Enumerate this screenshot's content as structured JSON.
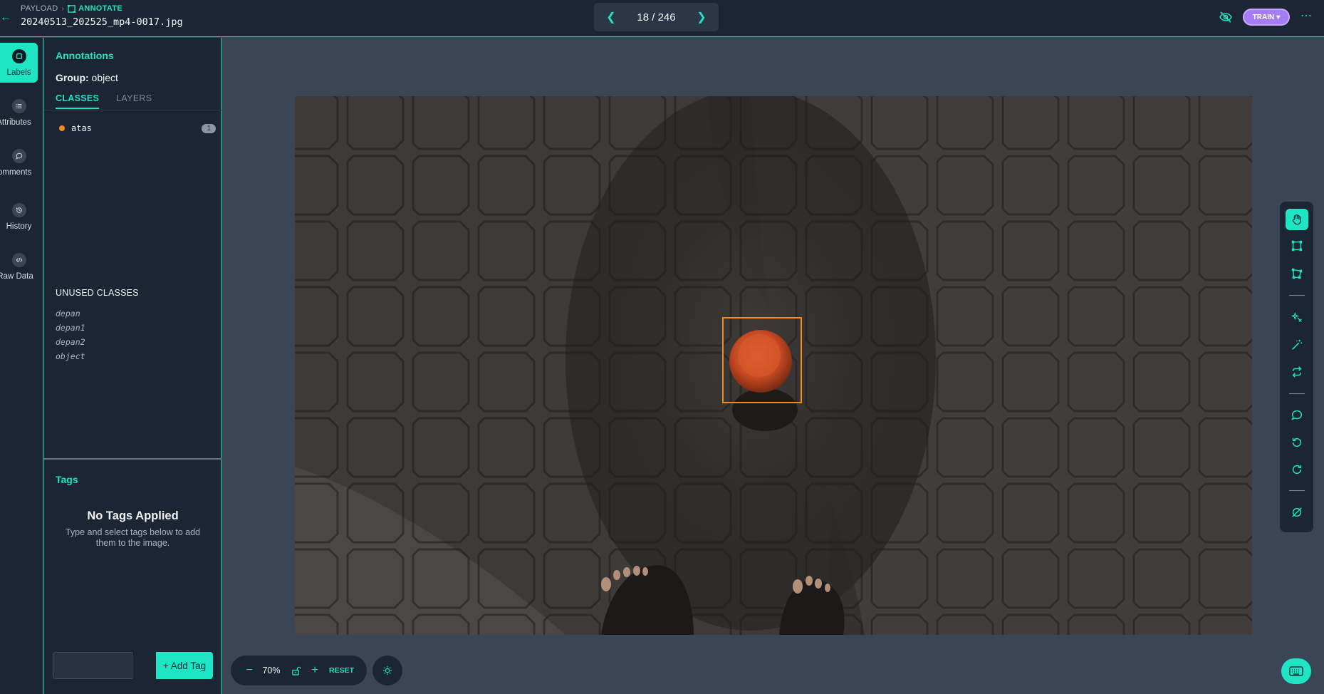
{
  "breadcrumb": {
    "root": "PAYLOAD",
    "current": "ANNOTATE"
  },
  "filename": "20240513_202525_mp4-0017.jpg",
  "pager": {
    "text": "18 / 246",
    "current": 18,
    "total": 246
  },
  "mode_button": "TRAIN",
  "rail": [
    {
      "label": "Labels",
      "icon": "label-icon",
      "active": true
    },
    {
      "label": "Attributes",
      "icon": "list-icon",
      "active": false
    },
    {
      "label": "Comments",
      "icon": "comment-icon",
      "active": false
    },
    {
      "label": "History",
      "icon": "history-icon",
      "active": false
    },
    {
      "label": "Raw Data",
      "icon": "code-icon",
      "active": false
    }
  ],
  "panel": {
    "title": "Annotations",
    "group_label": "Group:",
    "group_value": "object",
    "tabs": [
      {
        "label": "CLASSES",
        "active": true
      },
      {
        "label": "LAYERS",
        "active": false
      }
    ],
    "classes": [
      {
        "name": "atas",
        "count": "1",
        "color": "#f28a1c"
      }
    ],
    "unused_title": "UNUSED CLASSES",
    "unused_classes": [
      "depan",
      "depan1",
      "depan2",
      "object"
    ]
  },
  "tags": {
    "title": "Tags",
    "empty_title": "No Tags Applied",
    "empty_desc": "Type and select tags below to add them to the image.",
    "input_value": "",
    "add_button": "+ Add Tag"
  },
  "zoom": {
    "value": "70%",
    "reset": "RESET"
  },
  "colors": {
    "accent": "#1ee6c4",
    "bbox": "#f28a1c",
    "train": "#a67cf5",
    "panel": "#1b2533",
    "canvas": "#3a4556"
  }
}
